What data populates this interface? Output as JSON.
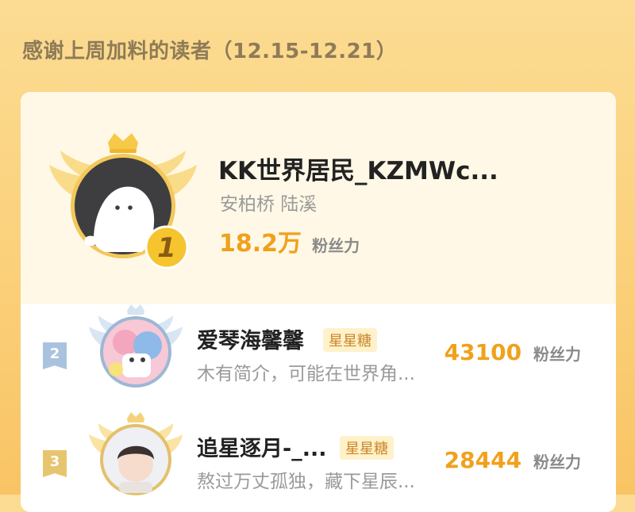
{
  "title": "感谢上周加料的读者（12.15-12.21）",
  "top_reader": {
    "rank": "1",
    "name": "KK世界居民_KZMWc...",
    "subtitle": "安柏桥 陆溪",
    "score": "18.2万",
    "score_unit": "粉丝力"
  },
  "readers": [
    {
      "rank": "2",
      "name": "爱琴海馨馨",
      "tag": "星星糖",
      "bio": "木有简介，可能在世界角...",
      "score": "43100",
      "score_unit": "粉丝力"
    },
    {
      "rank": "3",
      "name": "追星逐月-_...",
      "tag": "星星糖",
      "bio": "熬过万丈孤独，藏下星辰...",
      "score": "28444",
      "score_unit": "粉丝力"
    }
  ],
  "colors": {
    "accent": "#f0a11c",
    "rank2": "#a9c3de",
    "rank3": "#e7c56e",
    "gold": "#f3c22a"
  },
  "icons": [
    "crown-icon",
    "wings-icon",
    "rank-medal-icon"
  ]
}
